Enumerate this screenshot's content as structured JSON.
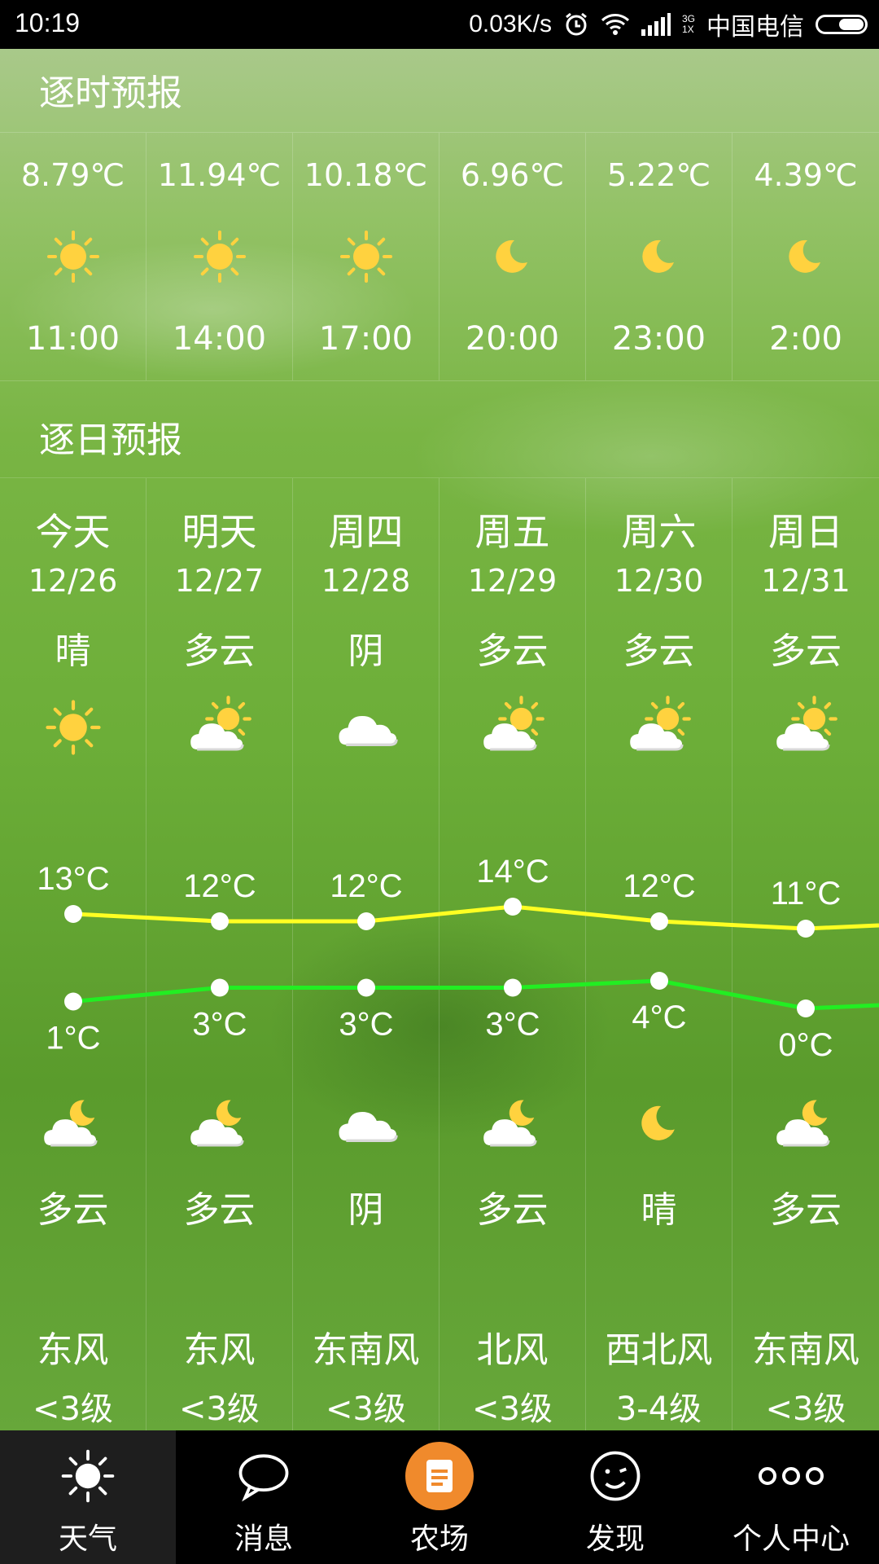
{
  "status": {
    "time": "10:19",
    "speed": "0.03K/s",
    "net_top": "3G",
    "net_bottom": "1X",
    "carrier": "中国电信"
  },
  "hourly": {
    "title": "逐时预报",
    "items": [
      {
        "temp": "8.79℃",
        "icon": "sun-icon",
        "time": "11:00"
      },
      {
        "temp": "11.94℃",
        "icon": "sun-icon",
        "time": "14:00"
      },
      {
        "temp": "10.18℃",
        "icon": "sun-icon",
        "time": "17:00"
      },
      {
        "temp": "6.96℃",
        "icon": "moon-icon",
        "time": "20:00"
      },
      {
        "temp": "5.22℃",
        "icon": "moon-icon",
        "time": "23:00"
      },
      {
        "temp": "4.39℃",
        "icon": "moon-icon",
        "time": "2:00"
      }
    ]
  },
  "daily": {
    "title": "逐日预报",
    "items": [
      {
        "day": "今天",
        "date": "12/26",
        "day_cond": "晴",
        "day_icon": "sun-icon",
        "high": "13°C",
        "low": "1°C",
        "night_icon": "moon-cloud-icon",
        "night_cond": "多云",
        "wind_dir": "东风",
        "wind_level": "<3级"
      },
      {
        "day": "明天",
        "date": "12/27",
        "day_cond": "多云",
        "day_icon": "sun-cloud-icon",
        "high": "12°C",
        "low": "3°C",
        "night_icon": "moon-cloud-icon",
        "night_cond": "多云",
        "wind_dir": "东风",
        "wind_level": "<3级"
      },
      {
        "day": "周四",
        "date": "12/28",
        "day_cond": "阴",
        "day_icon": "cloud-icon",
        "high": "12°C",
        "low": "3°C",
        "night_icon": "cloud-icon",
        "night_cond": "阴",
        "wind_dir": "东南风",
        "wind_level": "<3级"
      },
      {
        "day": "周五",
        "date": "12/29",
        "day_cond": "多云",
        "day_icon": "sun-cloud-icon",
        "high": "14°C",
        "low": "3°C",
        "night_icon": "moon-cloud-icon",
        "night_cond": "多云",
        "wind_dir": "北风",
        "wind_level": "<3级"
      },
      {
        "day": "周六",
        "date": "12/30",
        "day_cond": "多云",
        "day_icon": "sun-cloud-icon",
        "high": "12°C",
        "low": "4°C",
        "night_icon": "moon-icon",
        "night_cond": "晴",
        "wind_dir": "西北风",
        "wind_level": "3-4级"
      },
      {
        "day": "周日",
        "date": "12/31",
        "day_cond": "多云",
        "day_icon": "sun-cloud-icon",
        "high": "11°C",
        "low": "0°C",
        "night_icon": "moon-cloud-icon",
        "night_cond": "多云",
        "wind_dir": "东南风",
        "wind_level": "<3级"
      }
    ],
    "high_line_color": "#ffff22",
    "low_line_color": "#22ee22"
  },
  "chart_data": {
    "type": "line",
    "categories": [
      "今天",
      "明天",
      "周四",
      "周五",
      "周六",
      "周日"
    ],
    "series": [
      {
        "values": [
          13,
          12,
          12,
          14,
          12,
          11
        ]
      },
      {
        "values": [
          1,
          3,
          3,
          3,
          4,
          0
        ]
      }
    ]
  },
  "tabs": [
    {
      "label": "天气",
      "icon": "sun-icon",
      "active": true
    },
    {
      "label": "消息",
      "icon": "chat-bubble-icon",
      "active": false
    },
    {
      "label": "农场",
      "icon": "document-icon",
      "active": false
    },
    {
      "label": "发现",
      "icon": "wink-face-icon",
      "active": false
    },
    {
      "label": "个人中心",
      "icon": "dots-icon",
      "active": false
    }
  ],
  "colors": {
    "accent": "#f08a2c",
    "sun": "#ffd23f"
  }
}
